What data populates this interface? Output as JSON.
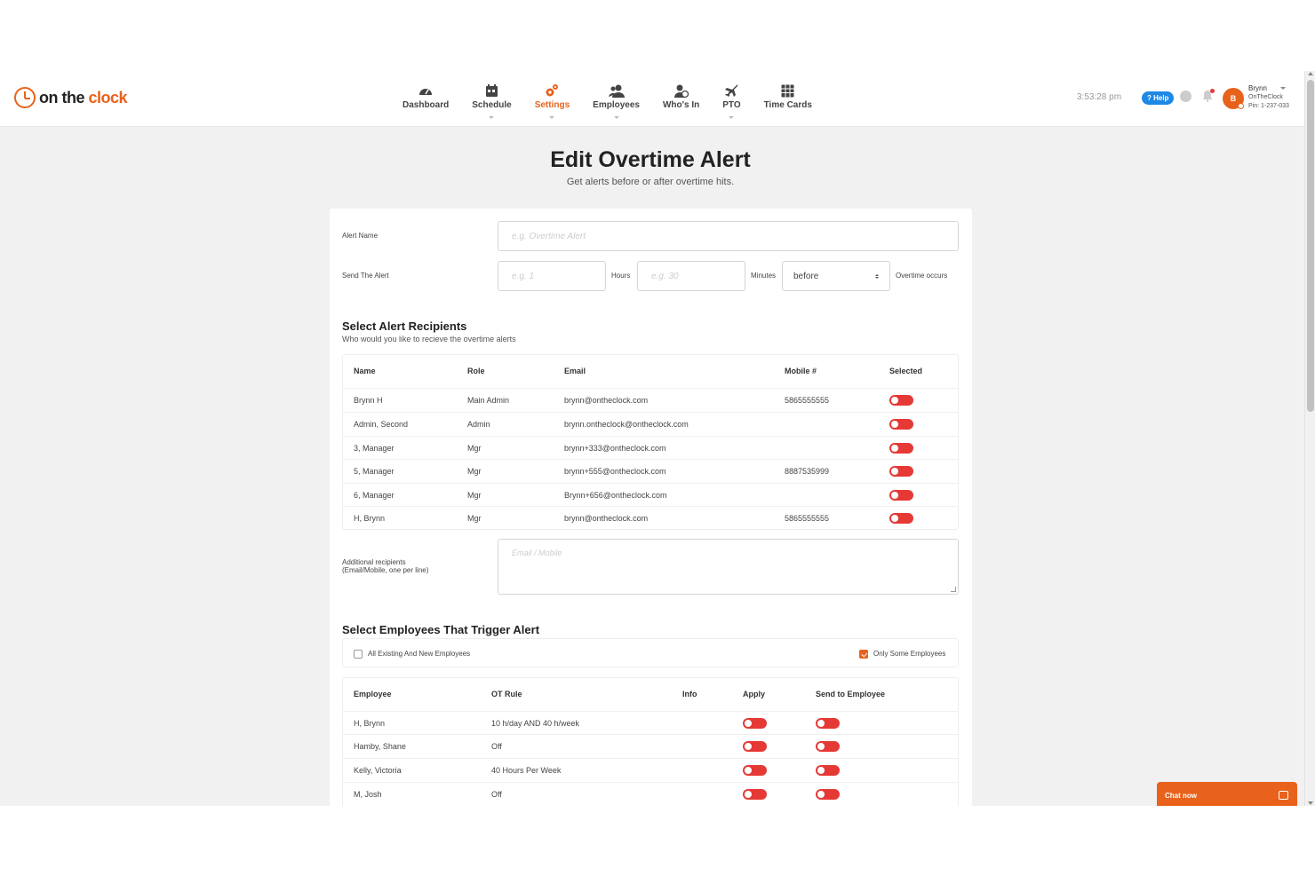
{
  "brand": {
    "part1": "on the ",
    "part2": "clock"
  },
  "nav": [
    {
      "label": "Dashboard"
    },
    {
      "label": "Schedule"
    },
    {
      "label": "Settings"
    },
    {
      "label": "Employees"
    },
    {
      "label": "Who's In"
    },
    {
      "label": "PTO"
    },
    {
      "label": "Time Cards"
    }
  ],
  "header": {
    "clock": "3:53:28 pm",
    "help": "? Help",
    "avatar_initial": "B",
    "user_name": "Brynn",
    "company": "OnTheClock",
    "pin": "Pin: 1-237-033"
  },
  "page": {
    "title": "Edit Overtime Alert",
    "subtitle": "Get alerts before or after overtime hits."
  },
  "form": {
    "alert_name_label": "Alert Name",
    "alert_name_placeholder": "e.g. Overtime Alert",
    "send_label": "Send The Alert",
    "hours_placeholder": "e.g. 1",
    "hours_label": "Hours",
    "minutes_placeholder": "e.g. 30",
    "minutes_label": "Minutes",
    "timing_value": "before",
    "overtime_label": "Overtime occurs"
  },
  "recipients": {
    "title": "Select Alert Recipients",
    "subtitle": "Who would you like to recieve the overtime alerts",
    "columns": [
      "Name",
      "Role",
      "Email",
      "Mobile #",
      "Selected"
    ],
    "rows": [
      {
        "name": "Brynn H",
        "role": "Main Admin",
        "email": "brynn@ontheclock.com",
        "mobile": "5865555555"
      },
      {
        "name": "Admin, Second",
        "role": "Admin",
        "email": "brynn.ontheclock@ontheclock.com",
        "mobile": ""
      },
      {
        "name": "3, Manager",
        "role": "Mgr",
        "email": "brynn+333@ontheclock.com",
        "mobile": ""
      },
      {
        "name": "5, Manager",
        "role": "Mgr",
        "email": "brynn+555@ontheclock.com",
        "mobile": "8887535999"
      },
      {
        "name": "6, Manager",
        "role": "Mgr",
        "email": "Brynn+656@ontheclock.com",
        "mobile": ""
      },
      {
        "name": "H, Brynn",
        "role": "Mgr",
        "email": "brynn@ontheclock.com",
        "mobile": "5865555555"
      }
    ],
    "additional_label_1": "Additional recipients",
    "additional_label_2": "(Email/Mobile, one per line)",
    "additional_placeholder": "Email / Mobile"
  },
  "employees": {
    "title": "Select Employees That Trigger Alert",
    "all_label": "All Existing And New Employees",
    "some_label": "Only Some Employees",
    "columns": [
      "Employee",
      "OT Rule",
      "Info",
      "Apply",
      "Send to Employee"
    ],
    "rows": [
      {
        "name": "H, Brynn",
        "rule": "10 h/day AND 40 h/week"
      },
      {
        "name": "Hamby, Shane",
        "rule": "Off"
      },
      {
        "name": "Kelly, Victoria",
        "rule": "40 Hours Per Week"
      },
      {
        "name": "M, Josh",
        "rule": "Off"
      }
    ]
  },
  "chat": {
    "label": "Chat now"
  },
  "colors": {
    "accent": "#e8621b",
    "toggle": "#e53935",
    "help": "#1e88e5"
  }
}
